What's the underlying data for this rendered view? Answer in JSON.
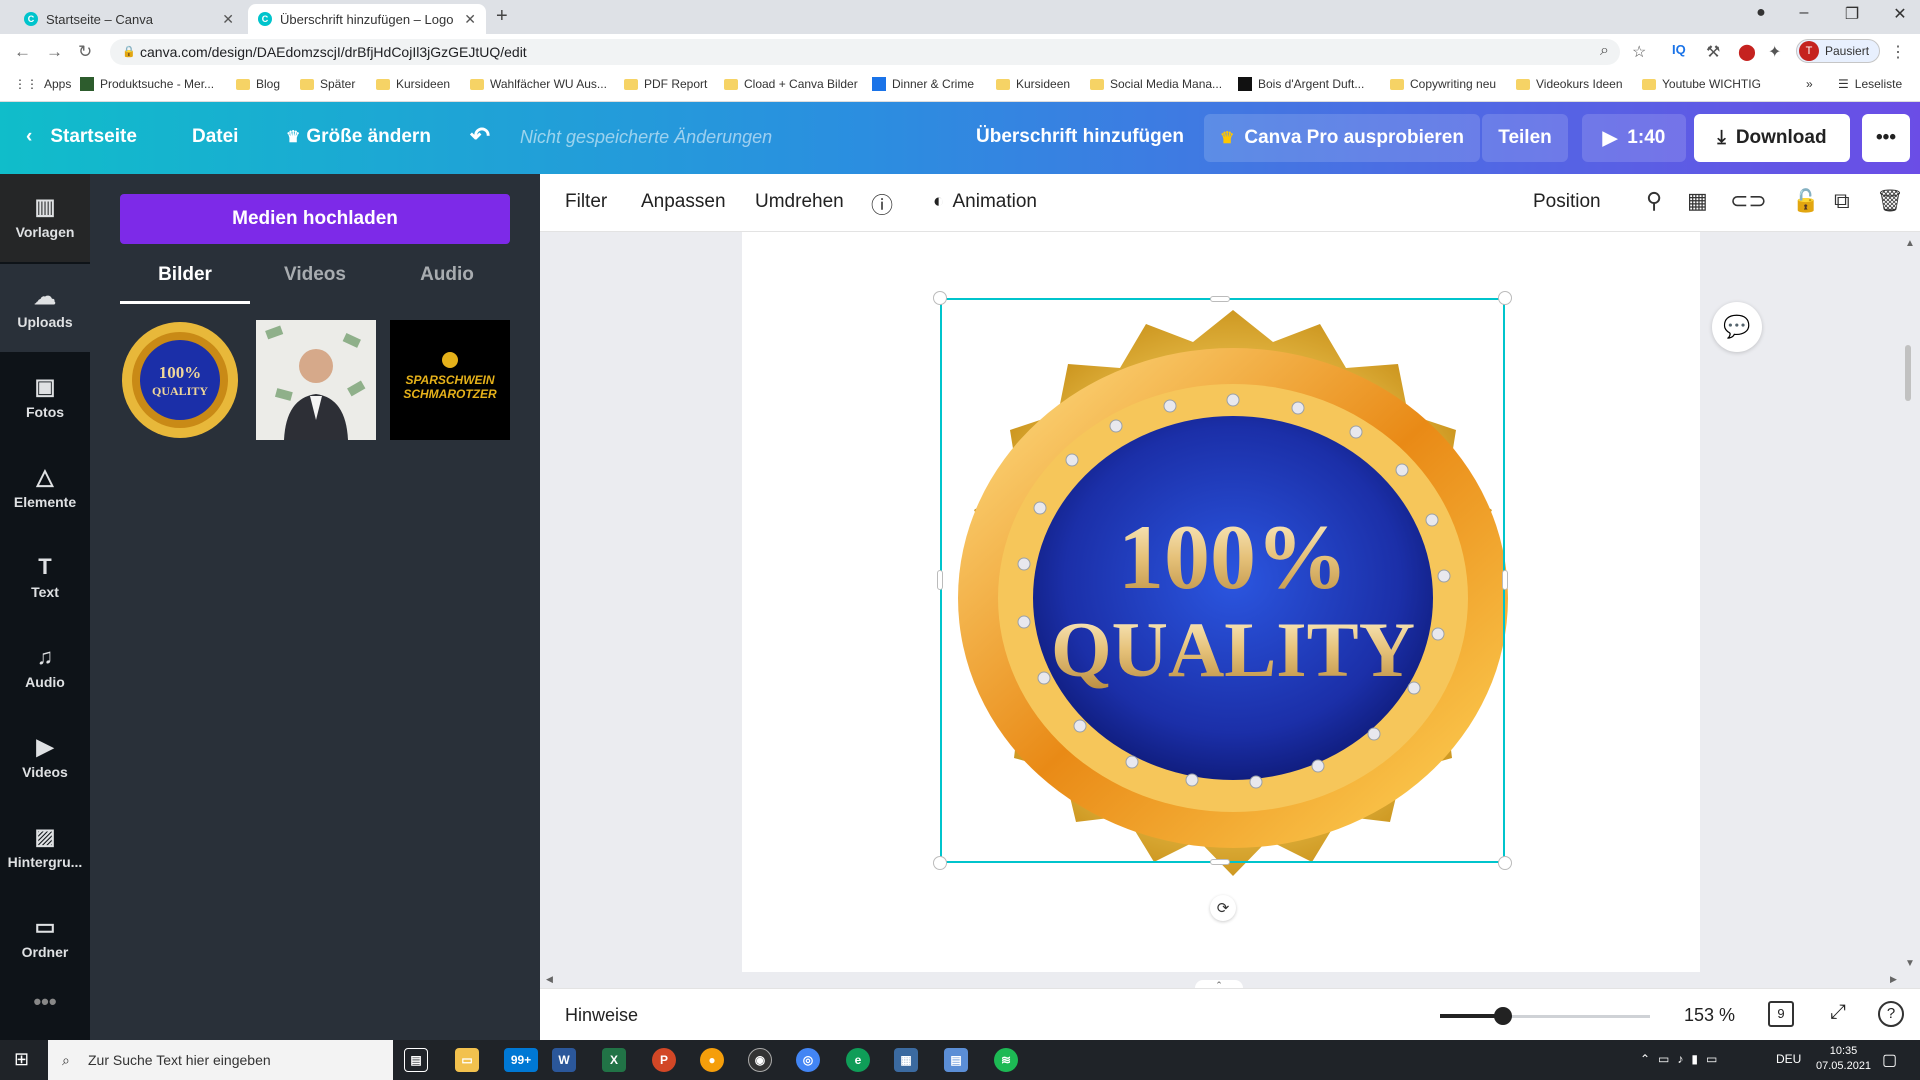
{
  "browser": {
    "tabs": [
      {
        "title": "Startseite – Canva",
        "active": false
      },
      {
        "title": "Überschrift hinzufügen – Logo",
        "active": true
      }
    ],
    "url": "canva.com/design/DAEdomzscjI/drBfjHdCojIl3jGzGEJtUQ/edit",
    "profile_initial": "T",
    "profile_label": "Pausiert",
    "bookmarks": [
      "Apps",
      "Produktsuche - Mer...",
      "Blog",
      "Später",
      "Kursideen",
      "Wahlfächer WU Aus...",
      "PDF Report",
      "Cload + Canva Bilder",
      "Dinner & Crime",
      "Kursideen",
      "Social Media Mana...",
      "Bois d'Argent Duft...",
      "Copywriting neu",
      "Videokurs Ideen",
      "Youtube WICHTIG"
    ],
    "reading_list": "Leseliste"
  },
  "header": {
    "home": "Startseite",
    "file": "Datei",
    "resize": "Größe ändern",
    "unsaved": "Nicht gespeicherte Änderungen",
    "title": "Überschrift hinzufügen",
    "pro": "Canva Pro ausprobieren",
    "share": "Teilen",
    "play_time": "1:40",
    "download": "Download"
  },
  "rail": [
    {
      "label": "Vorlagen",
      "icon": "layout-icon"
    },
    {
      "label": "Uploads",
      "icon": "cloud-upload-icon"
    },
    {
      "label": "Fotos",
      "icon": "image-icon"
    },
    {
      "label": "Elemente",
      "icon": "shapes-icon"
    },
    {
      "label": "Text",
      "icon": "text-icon"
    },
    {
      "label": "Audio",
      "icon": "music-icon"
    },
    {
      "label": "Videos",
      "icon": "video-icon"
    },
    {
      "label": "Hintergru...",
      "icon": "background-icon"
    },
    {
      "label": "Ordner",
      "icon": "folder-icon"
    }
  ],
  "panel": {
    "upload_button": "Medien hochladen",
    "tabs": [
      "Bilder",
      "Videos",
      "Audio"
    ],
    "thumb1_line1": "100%",
    "thumb1_line2": "QUALITY",
    "thumb3_line1": "SPARSCHWEIN",
    "thumb3_line2": "SCHMAROTZER"
  },
  "toolbar": {
    "filter": "Filter",
    "adjust": "Anpassen",
    "flip": "Umdrehen",
    "animation": "Animation",
    "position": "Position"
  },
  "canvas": {
    "badge_line1": "100%",
    "badge_line2": "QUALITY"
  },
  "bottom": {
    "notes": "Hinweise",
    "zoom": "153 %",
    "page_count": "9",
    "zoom_level": 0.3
  },
  "taskbar": {
    "search_placeholder": "Zur Suche Text hier eingeben",
    "language": "DEU",
    "time": "10:35",
    "date": "07.05.2021",
    "mail_badge": "99+"
  },
  "colors": {
    "purple": "#7d2ae8",
    "teal": "#00c4cc",
    "panel": "#293039",
    "rail": "#0e1318"
  }
}
